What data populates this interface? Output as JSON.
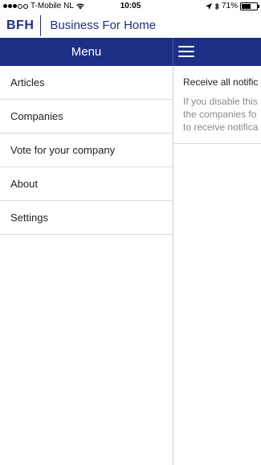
{
  "status_bar": {
    "carrier": "T-Mobile NL",
    "time": "10:05",
    "battery": "71%",
    "battery_level": 0.71
  },
  "header": {
    "logo": "BFH",
    "title": "Business For Home"
  },
  "nav": {
    "menu_title": "Menu"
  },
  "menu": {
    "items": [
      {
        "label": "Articles"
      },
      {
        "label": "Companies"
      },
      {
        "label": "Vote for your company"
      },
      {
        "label": "About"
      },
      {
        "label": "Settings"
      }
    ]
  },
  "content": {
    "setting_title": "Receive all notific",
    "setting_desc_1": "If you disable this",
    "setting_desc_2": "the companies fo",
    "setting_desc_3": "to receive notifica"
  },
  "colors": {
    "brand": "#1e2f86",
    "divider": "#d9d9d9",
    "muted_text": "#8a8a8a"
  }
}
